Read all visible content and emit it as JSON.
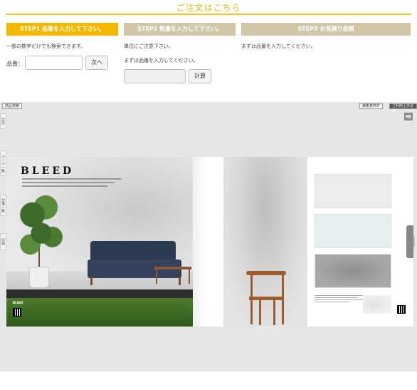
{
  "order": {
    "title": "ご注文はこちら",
    "step1_label": "STEP1 品番を入力して下さい。",
    "step2_label": "STEP2 数量を入力して下さい。",
    "step3_label": "STEP3 お見積り金額",
    "step1_note": "一部の数字だけでも検索できます。",
    "step2_note1": "単位にご注意下さい。",
    "step2_note2": "まずは品番を入力してください。",
    "step3_note": "まずは品番を入力してください。",
    "part_label": "品番：",
    "part_value": "",
    "next_button": "次へ",
    "qty_value": "",
    "calc_button": "計算"
  },
  "viewer": {
    "search_button": "商品検索",
    "price_pdf_button": "価格表PDF",
    "notice_button": "ご利用上の注意",
    "sidetabs": [
      "目次",
      "ページ一覧",
      "付箋一覧",
      "印刷"
    ],
    "left_page": {
      "title": "BLEED",
      "logo_text": "BLEED"
    },
    "colors": {
      "accent": "#f5b800",
      "step_inactive": "#cfc7a8"
    }
  }
}
